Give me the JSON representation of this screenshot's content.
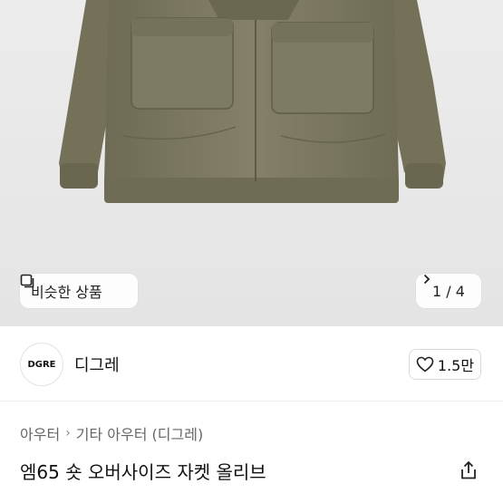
{
  "gallery": {
    "similar_label": "비슷한 상품",
    "page_indicator": "1 / 4"
  },
  "seller": {
    "logo_text": "DGRE",
    "name": "디그레",
    "likes": "1.5만"
  },
  "breadcrumb": {
    "level1": "아우터",
    "level2": "기타 아우터 (디그레)"
  },
  "product": {
    "title": "엠65 숏 오버사이즈 자켓 올리브"
  },
  "colors": {
    "jacket": "#7d7a62",
    "background": "#e8e8e8"
  }
}
